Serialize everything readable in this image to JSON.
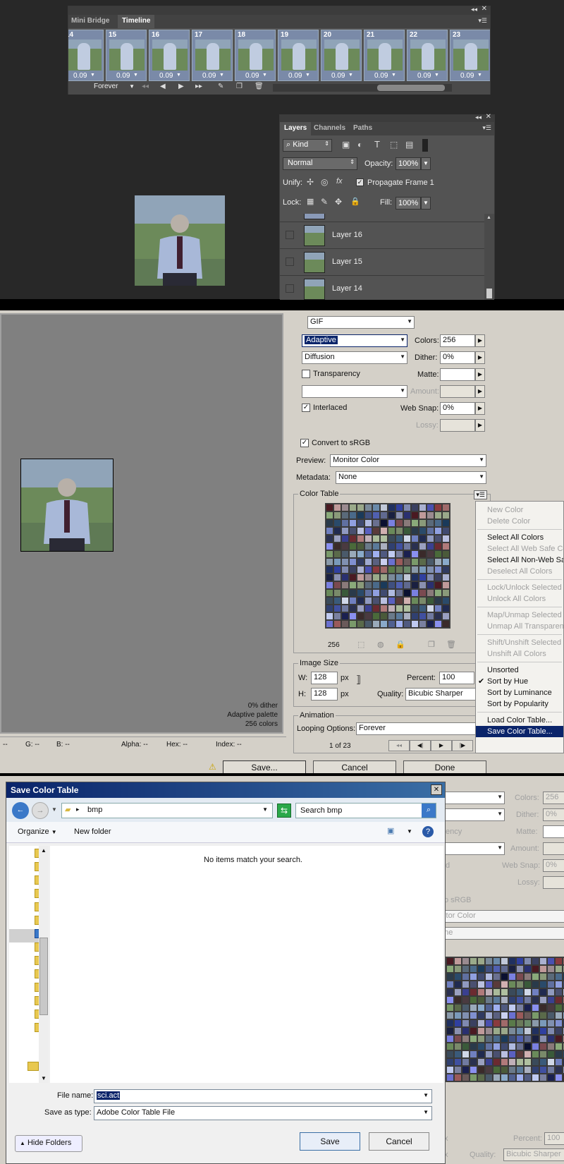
{
  "timeline": {
    "tabs": [
      "Mini Bridge",
      "Timeline"
    ],
    "frames": [
      {
        "num": "14",
        "delay": "0.09"
      },
      {
        "num": "15",
        "delay": "0.09"
      },
      {
        "num": "16",
        "delay": "0.09"
      },
      {
        "num": "17",
        "delay": "0.09"
      },
      {
        "num": "18",
        "delay": "0.09"
      },
      {
        "num": "19",
        "delay": "0.09"
      },
      {
        "num": "20",
        "delay": "0.09"
      },
      {
        "num": "21",
        "delay": "0.09"
      },
      {
        "num": "22",
        "delay": "0.09"
      },
      {
        "num": "23",
        "delay": "0.09"
      }
    ],
    "loop": "Forever"
  },
  "layers": {
    "tabs": [
      "Layers",
      "Channels",
      "Paths"
    ],
    "kind": "Kind",
    "blend": "Normal",
    "opacity_label": "Opacity:",
    "opacity": "100%",
    "unify_label": "Unify:",
    "propagate": "Propagate Frame 1",
    "lock_label": "Lock:",
    "fill_label": "Fill:",
    "fill": "100%",
    "items": [
      "Layer 16",
      "Layer 15",
      "Layer 14"
    ]
  },
  "sfw": {
    "format": "GIF",
    "reduction": "Adaptive",
    "colors_label": "Colors:",
    "colors": "256",
    "dither_algo": "Diffusion",
    "dither_label": "Dither:",
    "dither": "0%",
    "transparency": "Transparency",
    "matte_label": "Matte:",
    "amount_label": "Amount:",
    "interlaced": "Interlaced",
    "websnap_label": "Web Snap:",
    "websnap": "0%",
    "lossy_label": "Lossy:",
    "convert_srgb": "Convert to sRGB",
    "preview_label": "Preview:",
    "preview": "Monitor Color",
    "metadata_label": "Metadata:",
    "metadata": "None",
    "color_table_label": "Color Table",
    "color_count": "256",
    "image_size_label": "Image Size",
    "w_label": "W:",
    "w": "128",
    "h_label": "H:",
    "h": "128",
    "px": "px",
    "percent_label": "Percent:",
    "percent": "100",
    "quality_label": "Quality:",
    "quality": "Bicubic Sharper",
    "animation_label": "Animation",
    "looping_label": "Looping Options:",
    "looping": "Forever",
    "frame_counter": "1 of 23",
    "info_lines": [
      "0% dither",
      "Adaptive palette",
      "256 colors"
    ],
    "status": {
      "r": "--",
      "g": "G: --",
      "b": "B: --",
      "alpha": "Alpha: --",
      "hex": "Hex: --",
      "index": "Index: --"
    },
    "save_btn": "Save...",
    "cancel_btn": "Cancel",
    "done_btn": "Done"
  },
  "menu": {
    "items": [
      {
        "label": "New Color",
        "enabled": false,
        "checked": false
      },
      {
        "label": "Delete Color",
        "enabled": false,
        "checked": false
      },
      {
        "sep": true
      },
      {
        "label": "Select All Colors",
        "enabled": true,
        "checked": false
      },
      {
        "label": "Select All Web Safe Co",
        "enabled": false,
        "checked": false
      },
      {
        "label": "Select All Non-Web Sa",
        "enabled": true,
        "checked": false
      },
      {
        "label": "Deselect All Colors",
        "enabled": false,
        "checked": false
      },
      {
        "sep": true
      },
      {
        "label": "Lock/Unlock Selected C",
        "enabled": false,
        "checked": false
      },
      {
        "label": "Unlock All Colors",
        "enabled": false,
        "checked": false
      },
      {
        "sep": true
      },
      {
        "label": "Map/Unmap Selected C",
        "enabled": false,
        "checked": false
      },
      {
        "label": "Unmap All Transparent",
        "enabled": false,
        "checked": false
      },
      {
        "sep": true
      },
      {
        "label": "Shift/Unshift Selected",
        "enabled": false,
        "checked": false
      },
      {
        "label": "Unshift All Colors",
        "enabled": false,
        "checked": false
      },
      {
        "sep": true
      },
      {
        "label": "Unsorted",
        "enabled": true,
        "checked": false
      },
      {
        "label": "Sort by Hue",
        "enabled": true,
        "checked": true
      },
      {
        "label": "Sort by Luminance",
        "enabled": true,
        "checked": false
      },
      {
        "label": "Sort by Popularity",
        "enabled": true,
        "checked": false
      },
      {
        "sep": true
      },
      {
        "label": "Load Color Table...",
        "enabled": true,
        "checked": false
      },
      {
        "label": "Save Color Table...",
        "enabled": true,
        "checked": false,
        "highlight": true
      }
    ]
  },
  "dialog": {
    "title": "Save Color Table",
    "path": "bmp",
    "search_placeholder": "Search bmp",
    "organize": "Organize",
    "new_folder": "New folder",
    "empty_msg": "No items match your search.",
    "filename_label": "File name:",
    "filename": "sci.act",
    "savetype_label": "Save as type:",
    "savetype": "Adobe Color Table File",
    "hide_folders": "Hide Folders",
    "save": "Save",
    "cancel": "Cancel"
  },
  "bg_panel": {
    "colors_label": "Colors:",
    "colors": "256",
    "dither_label": "Dither:",
    "dither": "0%",
    "ency": "ency",
    "matte_label": "Matte:",
    "amount_label": "Amount:",
    "d": "d",
    "websnap_label": "Web Snap:",
    "websnap": "0%",
    "lossy_label": "Lossy:",
    "srgb": "o sRGB",
    "monitor": "nitor Color",
    "none": "one",
    "percent_label": "Percent:",
    "percent": "100",
    "quality_label": "Quality:",
    "quality": "Bicubic Sharper",
    "px": "px",
    "x": "x"
  },
  "palette_colors": [
    "#4a1a22",
    "#6b2a30",
    "#8a3a3e",
    "#5a3a3a",
    "#9a5a5a",
    "#7a4a50",
    "#3a2a2a",
    "#c09a9a",
    "#b07a7a",
    "#a06a6a",
    "#d0b0b0",
    "#6a5a5a",
    "#8a7a7a",
    "#4a3a40",
    "#9a8a90",
    "#c0b0b8",
    "#5a7a4a",
    "#6a8a5a",
    "#7a9a6a",
    "#8aaa7a",
    "#4a6a3a",
    "#9aaa8a",
    "#aaba9a",
    "#6a7a5a",
    "#7a8a6a",
    "#5a6a4a",
    "#8a9a7a",
    "#4a5a3a",
    "#9aa88a",
    "#b0c0a0",
    "#6a8a6a",
    "#3a5a3a",
    "#4a5a6a",
    "#5a6a7a",
    "#6a7a8a",
    "#7a8a9a",
    "#3a4a5a",
    "#8a9aaa",
    "#2a3a4a",
    "#9aaaba",
    "#4a6a8a",
    "#5a7a9a",
    "#6a8aaa",
    "#3a5a7a",
    "#7a9aba",
    "#2a4a6a",
    "#8aaaca",
    "#1a3a5a",
    "#aab0c0",
    "#c0c8d8",
    "#d0d8e8",
    "#8090b0",
    "#6070a0",
    "#506090",
    "#405080",
    "#304070",
    "#203060",
    "#7080c0",
    "#8090d0",
    "#90a0e0",
    "#a0b0f0",
    "#5060b0",
    "#4050a0",
    "#3040a0",
    "#202a50",
    "#303a60",
    "#404a70",
    "#505a80",
    "#606a90",
    "#707aa0",
    "#808ab0",
    "#909ac0",
    "#a0aad0",
    "#b0bae0",
    "#c0caf0",
    "#1a2040",
    "#2a3050",
    "#3a4060",
    "#4a5070",
    "#5a6080",
    "#6a7090",
    "#7a80a0",
    "#8a90b0",
    "#9aa0c0",
    "#aab0d0",
    "#bac0e0",
    "#cad0f0",
    "#0a1030",
    "#1a2050",
    "#2a3070",
    "#3a4090",
    "#4a50b0",
    "#5a60c0",
    "#6a70d0",
    "#7a80e0",
    "#8a90f0"
  ]
}
